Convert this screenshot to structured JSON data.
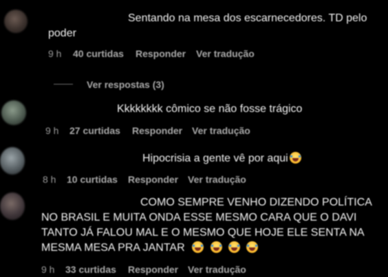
{
  "comments": [
    {
      "text_lines": [
        "Sentando na mesa dos escarnecedores. TD pelo",
        "poder"
      ],
      "time": "9 h",
      "likes": "40 curtidas",
      "reply": "Responder",
      "translate": "Ver tradução"
    },
    {
      "text_lines": [
        "Kkkkkkkk cômico se não fosse trágico"
      ],
      "time": "9 h",
      "likes": "27 curtidas",
      "reply": "Responder",
      "translate": "Ver tradução"
    },
    {
      "text_lines": [
        "Hipocrisia a gente vê por aqui"
      ],
      "time": "8 h",
      "likes": "10 curtidas",
      "reply": "Responder",
      "translate": "Ver tradução"
    },
    {
      "text_lines": [
        "COMO SEMPRE VENHO DIZENDO POLÍTICA",
        "NO BRASIL E MUITA ONDA ESSE MESMO CARA QUE O DAVI",
        "TANTO JÁ FALOU MAL E O MESMO QUE HOJE ELE SENTA NA",
        "MESMA MESA PRA JANTAR"
      ],
      "time": "9 h",
      "likes": "33 curtidas",
      "reply": "Responder",
      "translate": "Ver tradução"
    }
  ],
  "view_replies": "Ver respostas (3)",
  "emoji_name": "face-with-tears-of-joy-icon",
  "colors": {
    "background": "#000000",
    "text": "#f2f2f2",
    "meta": "#a8a8a8"
  }
}
